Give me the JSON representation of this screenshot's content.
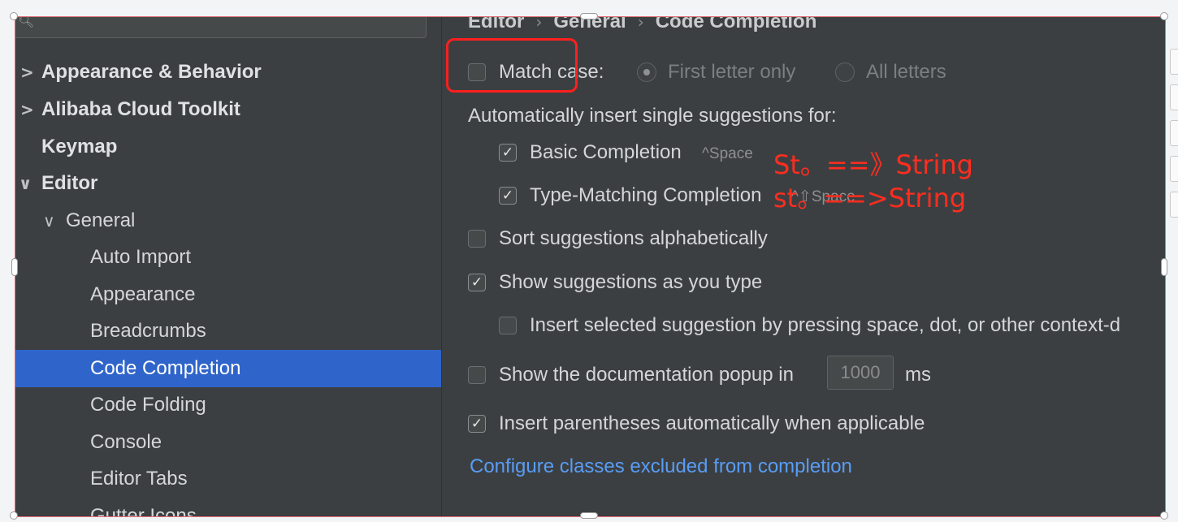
{
  "sidebar": {
    "search_icon": "magnifier-with-dropdown",
    "items": [
      {
        "label": "Appearance & Behavior",
        "chevron": ">",
        "bold": true
      },
      {
        "label": "Alibaba Cloud Toolkit",
        "chevron": ">",
        "bold": true
      },
      {
        "label": "Keymap",
        "chevron": "",
        "bold": true
      },
      {
        "label": "Editor",
        "chevron": "∨",
        "bold": true
      },
      {
        "label": "General",
        "chevron": "∨",
        "bold": false
      },
      {
        "label": "Auto Import",
        "chevron": "",
        "bold": false
      },
      {
        "label": "Appearance",
        "chevron": "",
        "bold": false
      },
      {
        "label": "Breadcrumbs",
        "chevron": "",
        "bold": false
      },
      {
        "label": "Code Completion",
        "chevron": "",
        "bold": false,
        "selected": true
      },
      {
        "label": "Code Folding",
        "chevron": "",
        "bold": false
      },
      {
        "label": "Console",
        "chevron": "",
        "bold": false
      },
      {
        "label": "Editor Tabs",
        "chevron": "",
        "bold": false
      },
      {
        "label": "Gutter Icons",
        "chevron": "",
        "bold": false
      }
    ]
  },
  "breadcrumb": {
    "parts": [
      "Editor",
      "General",
      "Code Completion"
    ],
    "separator": "›"
  },
  "options": {
    "match_case": {
      "label": "Match case:",
      "checked": false
    },
    "first_letter": {
      "label": "First letter only",
      "selected": true
    },
    "all_letters": {
      "label": "All letters",
      "selected": false
    },
    "auto_insert_header": "Automatically insert single suggestions for:",
    "basic_completion": {
      "label": "Basic Completion",
      "shortcut": "^Space",
      "checked": true
    },
    "type_matching": {
      "label": "Type-Matching Completion",
      "shortcut": "^⇧Space",
      "checked": true
    },
    "sort_alpha": {
      "label": "Sort suggestions alphabetically",
      "checked": false
    },
    "show_as_type": {
      "label": "Show suggestions as you type",
      "checked": true
    },
    "insert_selected": {
      "label": "Insert selected suggestion by pressing space, dot, or other context-d",
      "checked": false
    },
    "doc_popup": {
      "label": "Show the documentation popup in",
      "value": "1000",
      "unit": "ms",
      "checked": false
    },
    "insert_parens": {
      "label": "Insert parentheses automatically when applicable",
      "checked": true
    },
    "configure_link": "Configure classes excluded from completion"
  },
  "annotations": {
    "line1": "St。==》String",
    "line2": "st。==>String"
  },
  "colors": {
    "background": "#3c3f41",
    "selection": "#2f65ca",
    "link": "#589df6",
    "annotation": "#ff2d1f"
  }
}
